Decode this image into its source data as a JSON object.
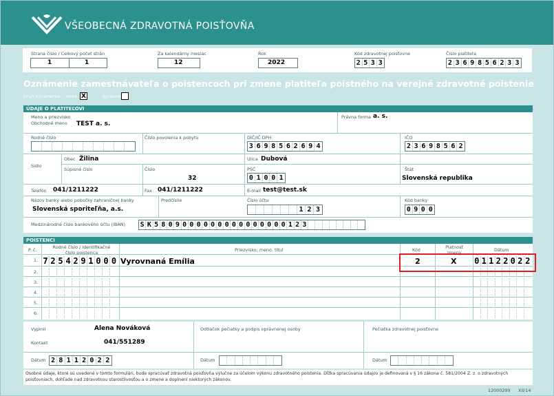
{
  "brand": {
    "name": "VŠEOBECNÁ ZDRAVOTNÁ POISŤOVŇA",
    "logo": "vzp-wave-logo"
  },
  "top": {
    "page_label": "Strana číslo / Celkový počet strán",
    "page_num": "1",
    "page_total": "1",
    "month_label": "Za kalendárny mesiac",
    "month": "12",
    "year_label": "Rok",
    "year": "2022",
    "insurer_code_label": "Kód zdravotnej poisťovne",
    "insurer_code": [
      "2",
      "5",
      "3",
      "3"
    ],
    "payer_no_label": "Číslo platiteľa",
    "payer_no": [
      "2",
      "3",
      "6",
      "9",
      "8",
      "5",
      "6",
      "2",
      "3",
      "3"
    ]
  },
  "title": "Oznámenie zamestnávateľa o poistencoch pri zmene platiteľa poistného na verejné zdravotné poistenie",
  "notice_type": {
    "label": "Druh oznámenia:",
    "new_label": "nové",
    "new_value": "X",
    "corrected_label": "opravné",
    "corrected_value": ""
  },
  "payer": {
    "section": "ÚDAJE O PLATITEĽOVI",
    "name_label": "Meno a priezvisko",
    "business_label": "Obchodné meno",
    "business_name": "TEST a. s.",
    "legal_form_label": "Právna forma",
    "legal_form": "a. s.",
    "birth_no_label": "Rodné číslo",
    "residence_permit_label": "Číslo povolenia k pobytu",
    "dic_label": "DIČ/IČ DPH",
    "dic": [
      "3",
      "6",
      "9",
      "8",
      "5",
      "6",
      "2",
      "6",
      "9",
      "4"
    ],
    "ico_label": "IČO",
    "ico": [
      "2",
      "3",
      "6",
      "9",
      "8",
      "5",
      "6",
      "2"
    ],
    "seat_label": "Sídlo",
    "city_label": "Obec",
    "city": "Žilina",
    "street_label": "Ulica",
    "street": "Dubová",
    "sup_no_label": "Súpisné číslo",
    "number_label": "Číslo",
    "number": "32",
    "psc_label": "PSČ",
    "psc": [
      "0",
      "1",
      "0",
      "0",
      "1"
    ],
    "state_label": "Štát",
    "state": "Slovenská republika",
    "phone_label": "Telefón",
    "phone": "041/1211222",
    "fax_label": "Fax",
    "fax": "041/1211222",
    "email_label": "E-mail",
    "email": "test@test.sk",
    "bank_name_label": "Názov banky alebo pobočky zahraničnej banky",
    "bank_name": "Slovenská sporiteľňa, a.s.",
    "prefix_label": "Predčíslie",
    "account_label": "Číslo účtu",
    "account": [
      "",
      "",
      "",
      "",
      "",
      "",
      "1",
      "2",
      "3"
    ],
    "bank_code_label": "Kód banky",
    "bank_code": [
      "0",
      "9",
      "0",
      "0"
    ],
    "iban_label": "Medzinárodné číslo bankového účtu (IBAN)",
    "iban": [
      "S",
      "K",
      "5",
      "8",
      "0",
      "9",
      "0",
      "0",
      "0",
      "0",
      "0",
      "0",
      "0",
      "0",
      "0",
      "0",
      "0",
      "0",
      "0",
      "0",
      "0",
      "1",
      "2",
      "3",
      "",
      "",
      "",
      "",
      "",
      "",
      "",
      ""
    ]
  },
  "insured": {
    "section": "POISTENCI",
    "col_pc": "P. č.",
    "col_id": "Rodné číslo / Identifikačné číslo poistenca",
    "col_name": "Priezvisko, meno, titul",
    "col_code": "Kód",
    "col_valid": "Platnosť zmeny",
    "col_date": "Dátum",
    "rows": [
      {
        "n": "1.",
        "id": [
          "7",
          "2",
          "5",
          "4",
          "2",
          "9",
          "1",
          "0",
          "0",
          "0"
        ],
        "name": "Vyrovnaná Emília",
        "code": "2",
        "valid": "X",
        "date": [
          "0",
          "1",
          "1",
          "2",
          "2",
          "0",
          "2",
          "2"
        ]
      },
      {
        "n": "2.",
        "id": [
          "",
          "",
          "",
          "",
          "",
          "",
          "",
          "",
          "",
          ""
        ],
        "name": "",
        "code": "",
        "valid": "",
        "date": [
          "",
          "",
          "",
          "",
          "",
          "",
          "",
          ""
        ]
      },
      {
        "n": "3.",
        "id": [
          "",
          "",
          "",
          "",
          "",
          "",
          "",
          "",
          "",
          ""
        ],
        "name": "",
        "code": "",
        "valid": "",
        "date": [
          "",
          "",
          "",
          "",
          "",
          "",
          "",
          ""
        ]
      },
      {
        "n": "4.",
        "id": [
          "",
          "",
          "",
          "",
          "",
          "",
          "",
          "",
          "",
          ""
        ],
        "name": "",
        "code": "",
        "valid": "",
        "date": [
          "",
          "",
          "",
          "",
          "",
          "",
          "",
          ""
        ]
      },
      {
        "n": "5.",
        "id": [
          "",
          "",
          "",
          "",
          "",
          "",
          "",
          "",
          "",
          ""
        ],
        "name": "",
        "code": "",
        "valid": "",
        "date": [
          "",
          "",
          "",
          "",
          "",
          "",
          "",
          ""
        ]
      },
      {
        "n": "6.",
        "id": [
          "",
          "",
          "",
          "",
          "",
          "",
          "",
          "",
          "",
          ""
        ],
        "name": "",
        "code": "",
        "valid": "",
        "date": [
          "",
          "",
          "",
          "",
          "",
          "",
          "",
          ""
        ]
      }
    ]
  },
  "footer": {
    "filled_label": "Vyplnil",
    "filled_by": "Alena Nováková",
    "contact_label": "Kontakt",
    "contact": "041/551289",
    "date_label": "Dátum",
    "date": [
      "2",
      "8",
      "1",
      "1",
      "2",
      "0",
      "2",
      "2"
    ],
    "stamp_label": "Odtlačok pečiatky a podpis oprávnenej osoby",
    "insurer_stamp_label": "Pečiatka zdravotnej poisťovne",
    "note": "Osobné údaje, ktoré sú uvedené v tomto formulári, bude spracúvať zdravotná poisťovňa výlučne za účelom výkonu zdravotného poistenia. Dĺžka spracúvania údajov je definovaná v § 16 zákona č. 581/2004 Z. z. o zdravotných poisťovniach, dohľade nad zdravotnou starostlivosťou a o zmene a doplnení niektorých zákonov.",
    "form_code": "12000299",
    "form_version": "XII/14"
  },
  "colors": {
    "teal": "#2b908e",
    "light": "#c9e4e4",
    "highlight": "#e01b22"
  }
}
